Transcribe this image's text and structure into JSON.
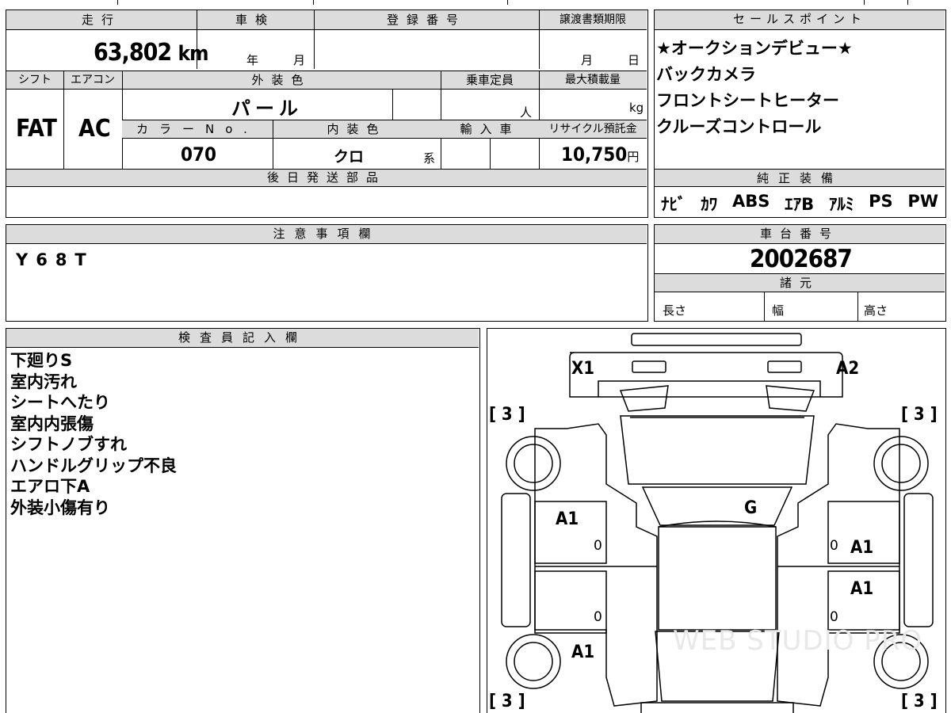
{
  "main_table": {
    "mileage": {
      "label": "走行",
      "value": "63,802",
      "unit": "km"
    },
    "shaken": {
      "label": "車検",
      "year_unit": "年",
      "month_unit": "月"
    },
    "registration": {
      "label": "登録番号"
    },
    "transfer_deadline": {
      "label": "譲渡書類期限",
      "month_unit": "月",
      "day_unit": "日"
    },
    "shift": {
      "label": "シフト",
      "value": "FAT"
    },
    "aircon": {
      "label": "エアコン",
      "value": "AC"
    },
    "exterior_color": {
      "label": "外装色",
      "value": "パール"
    },
    "capacity": {
      "label": "乗車定員",
      "unit": "人"
    },
    "max_load": {
      "label": "最大積載量",
      "unit": "kg"
    },
    "color_no": {
      "label": "カラーNo.",
      "value": "070"
    },
    "interior_color": {
      "label": "内装色",
      "value": "クロ",
      "suffix": "系"
    },
    "import": {
      "label": "輸入車"
    },
    "recycle_fee": {
      "label": "リサイクル預託金",
      "value": "10,750",
      "unit": "円"
    },
    "later_parts": {
      "label": "後日発送部品"
    }
  },
  "sales_points": {
    "header": "セールスポイント",
    "items": [
      "★オークションデビュー★",
      "バックカメラ",
      "フロントシートヒーター",
      "クルーズコントロール"
    ]
  },
  "genuine_equipment": {
    "header": "純正装備",
    "items": [
      "ﾅﾋﾞ",
      "ｶﾜ",
      "ABS",
      "ｴｱB",
      "ｱﾙﾐ",
      "PS",
      "PW"
    ]
  },
  "notes": {
    "header": "注意事項欄",
    "text": "Y68T"
  },
  "chassis": {
    "header": "車台番号",
    "value": "2002687"
  },
  "specs": {
    "header": "諸元",
    "length": "長さ",
    "width": "幅",
    "height": "高さ"
  },
  "inspector": {
    "header": "検査員記入欄",
    "lines": [
      "下廻りS",
      "室内汚れ",
      "シートへたり",
      "室内内張傷",
      "シフトノブすれ",
      "ハンドルグリップ不良",
      "エアロ下A",
      "外装小傷有り"
    ]
  },
  "diagram": {
    "marks": {
      "x1": "X1",
      "a2": "A2",
      "g": "G",
      "a1_left_front": "A1",
      "a1_right_front": "A1",
      "a1_right_rear": "A1",
      "a1_left_wheel": "A1",
      "zero": "0",
      "tire_tl": "[ 3 ]",
      "tire_tr": "[ 3 ]",
      "tire_bl": "[ 3 ]",
      "tire_br": "[ 3 ]"
    },
    "watermark": "WEB STUDIO PRO"
  }
}
